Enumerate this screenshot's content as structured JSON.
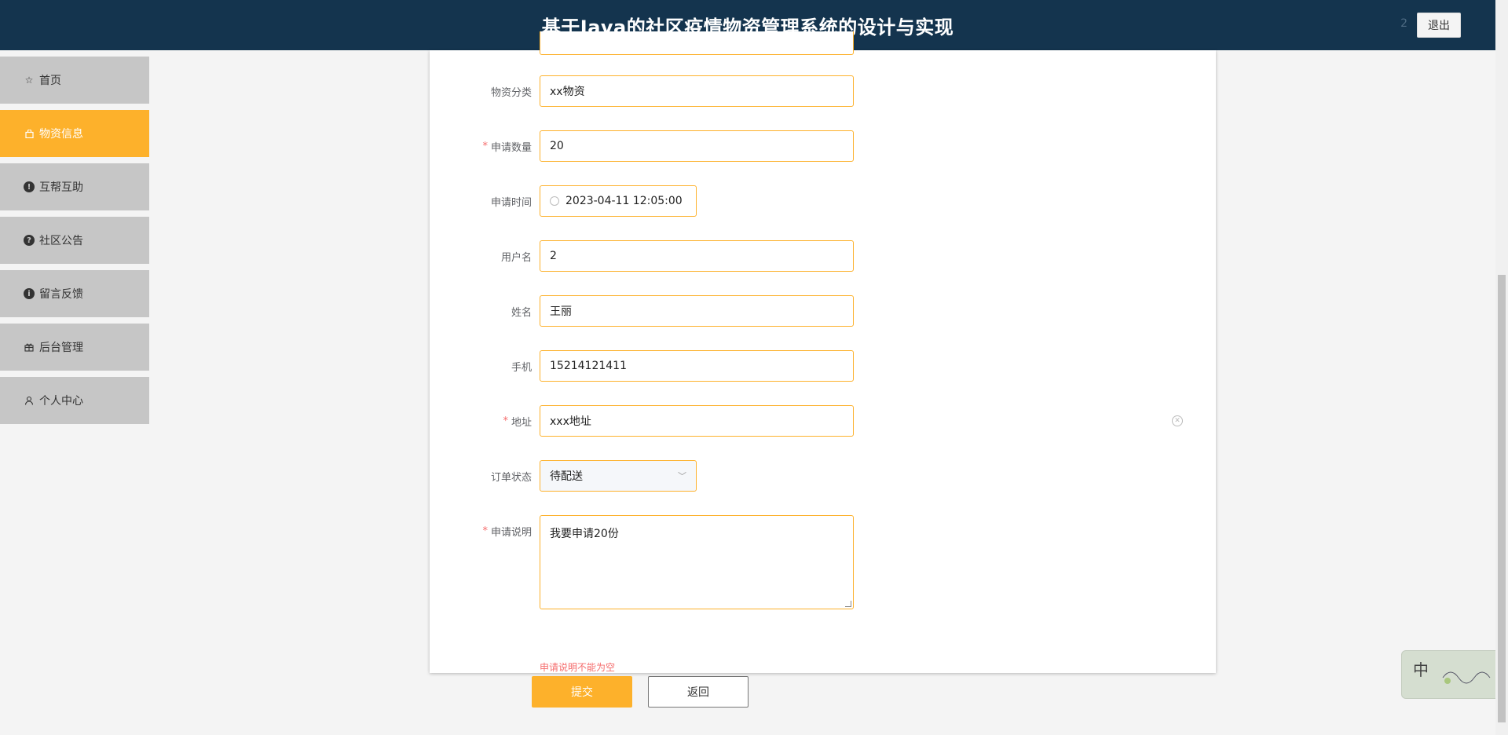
{
  "header": {
    "title": "基于Java的社区疫情物资管理系统的设计与实现",
    "user": "2",
    "logout_label": "退出"
  },
  "sidebar": {
    "items": [
      {
        "label": "首页",
        "icon": "star-icon"
      },
      {
        "label": "物资信息",
        "icon": "bag-icon",
        "active": true
      },
      {
        "label": "互帮互助",
        "icon": "info-circle-icon"
      },
      {
        "label": "社区公告",
        "icon": "question-circle-icon"
      },
      {
        "label": "留言反馈",
        "icon": "info-circle-icon"
      },
      {
        "label": "后台管理",
        "icon": "gift-icon"
      },
      {
        "label": "个人中心",
        "icon": "user-icon"
      }
    ]
  },
  "form": {
    "category_label": "物资分类",
    "category_value": "xx物资",
    "quantity_label": "申请数量",
    "quantity_value": "20",
    "time_label": "申请时间",
    "time_value": "2023-04-11 12:05:00",
    "username_label": "用户名",
    "username_value": "2",
    "name_label": "姓名",
    "name_value": "王丽",
    "phone_label": "手机",
    "phone_value": "15214121411",
    "address_label": "地址",
    "address_value": "xxx地址",
    "status_label": "订单状态",
    "status_value": "待配送",
    "desc_label": "申请说明",
    "desc_value": "我要申请20份",
    "desc_error": "申请说明不能为空",
    "required_mark": "*"
  },
  "buttons": {
    "submit": "提交",
    "back": "返回"
  },
  "ime": {
    "mode": "中"
  },
  "colors": {
    "header_bg": "#14344e",
    "accent": "#fdb12b",
    "sidebar_bg": "#c6c6c6",
    "error": "#f56c6c"
  }
}
